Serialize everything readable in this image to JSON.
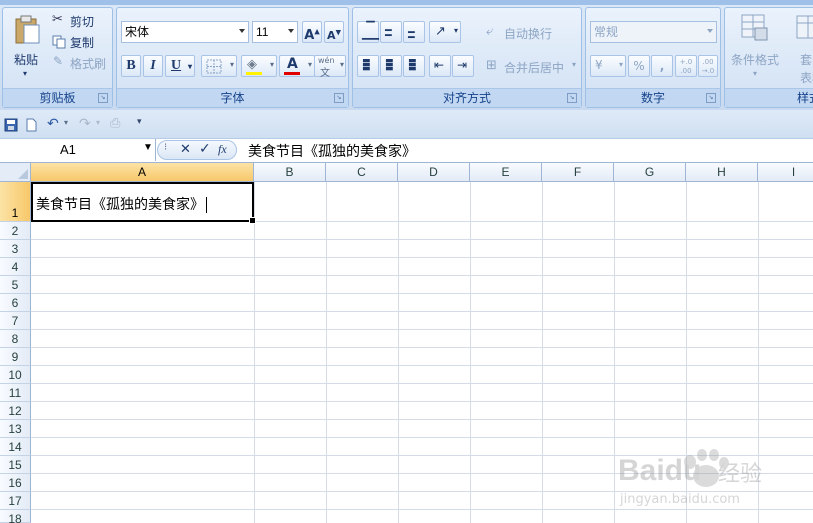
{
  "ribbon": {
    "clipboard": {
      "paste": "粘贴",
      "cut": "剪切",
      "copy": "复制",
      "format_painter": "格式刷",
      "group_label": "剪贴板"
    },
    "font": {
      "font_name": "宋体",
      "font_size": "11",
      "bold": "B",
      "italic": "I",
      "underline": "U",
      "font_color_letter": "A",
      "phonetic": "wén",
      "group_label": "字体"
    },
    "alignment": {
      "wrap_text": "自动换行",
      "merge_center": "合并后居中",
      "group_label": "对齐方式"
    },
    "number": {
      "format": "常规",
      "percent": "%",
      "comma": ",",
      "inc_decimal": "+.0 .00",
      "dec_decimal": ".00 →.0",
      "group_label": "数字"
    },
    "styles": {
      "conditional_format": "条件格式",
      "table_format_top": "套",
      "table_format_bottom": "表格格",
      "group_label": "样式"
    }
  },
  "formula_bar": {
    "cell_ref": "A1",
    "cancel": "✕",
    "enter": "✓",
    "fx": "fx",
    "content": "美食节目《孤独的美食家》"
  },
  "sheet": {
    "columns": [
      "A",
      "B",
      "C",
      "D",
      "E",
      "F",
      "G",
      "H",
      "I"
    ],
    "rows": [
      "1",
      "2",
      "3",
      "4",
      "5",
      "6",
      "7",
      "8",
      "9",
      "10",
      "11",
      "12",
      "13",
      "14",
      "15",
      "16",
      "17",
      "18"
    ],
    "active_cell": "A1",
    "a1_text": "美食节目《孤独的美食家》"
  },
  "watermark": {
    "brand": "Baidu",
    "brand_suffix": "经验",
    "url": "jingyan.baidu.com"
  },
  "colors": {
    "ribbon_bg": "#d6e4f5",
    "active_header": "#f8c86a",
    "font_color_red": "#e00000",
    "grid_line": "#d4dce8"
  }
}
